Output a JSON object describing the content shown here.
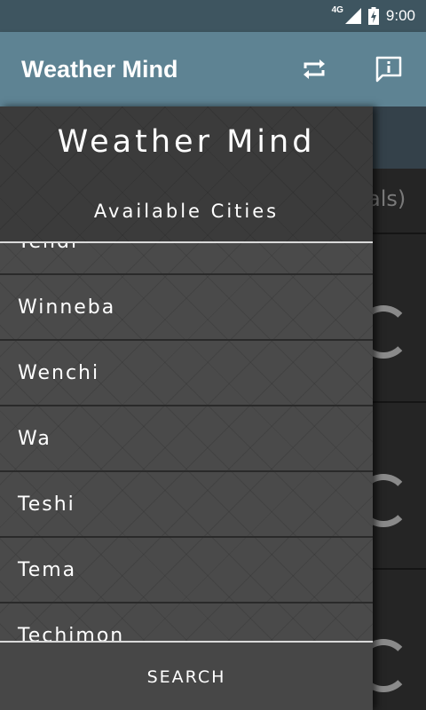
{
  "status_bar": {
    "network": "4G",
    "time": "9:00",
    "icons": [
      "signal-icon",
      "battery-charging-icon"
    ]
  },
  "app_bar": {
    "title": "Weather Mind",
    "actions": [
      "refresh-icon",
      "info-icon"
    ]
  },
  "background": {
    "partial_text": "als)"
  },
  "drawer": {
    "title": "Weather Mind",
    "subtitle": "Available Cities",
    "cities": [
      "Yendi",
      "Winneba",
      "Wenchi",
      "Wa",
      "Teshi",
      "Tema",
      "Techimon"
    ],
    "search_label": "SEARCH"
  },
  "colors": {
    "status_bar": "#3e5560",
    "app_bar": "#5e8393",
    "drawer": "#4a4a4a",
    "divider": "#d9d9d9"
  }
}
